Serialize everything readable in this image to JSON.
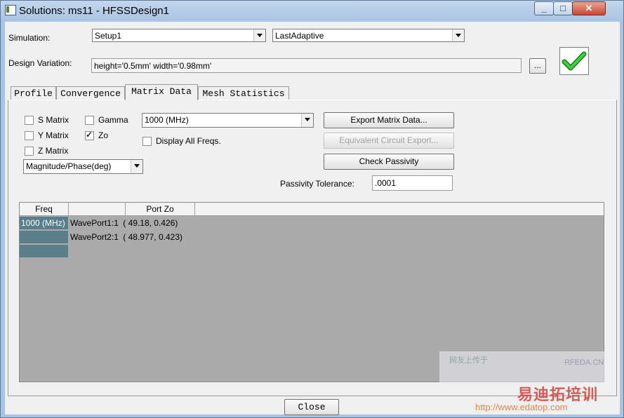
{
  "window": {
    "title": "Solutions: ms11 - HFSSDesign1"
  },
  "titlebar": {
    "minimize": "_",
    "maximize": "□",
    "close": "✕"
  },
  "simulation": {
    "label": "Simulation:",
    "setup": "Setup1",
    "solution": "LastAdaptive"
  },
  "design_variation": {
    "label": "Design Variation:",
    "value": "height='0.5mm' width='0.98mm'",
    "browse_button": "..."
  },
  "status_icon": "checkmark-icon",
  "tabs": [
    {
      "label": "Profile"
    },
    {
      "label": "Convergence"
    },
    {
      "label": "Matrix Data"
    },
    {
      "label": "Mesh Statistics"
    }
  ],
  "active_tab": "Matrix Data",
  "matrix_options": {
    "s_matrix": {
      "label": "S Matrix",
      "checked": false
    },
    "y_matrix": {
      "label": "Y Matrix",
      "checked": false
    },
    "z_matrix": {
      "label": "Z Matrix",
      "checked": false
    },
    "gamma": {
      "label": "Gamma",
      "checked": false
    },
    "zo": {
      "label": "Zo",
      "checked": true
    },
    "display_all_freqs": {
      "label": "Display All Freqs.",
      "checked": false
    },
    "frequency": "1000 (MHz)",
    "format": "Magnitude/Phase(deg)",
    "checkmark": "✓"
  },
  "buttons": {
    "export_matrix": "Export Matrix Data...",
    "equiv_circuit": "Equivalent Circuit Export...",
    "check_passivity": "Check Passivity",
    "close": "Close"
  },
  "passivity": {
    "label": "Passivity Tolerance:",
    "value": ".0001"
  },
  "grid": {
    "headers": [
      "Freq",
      "",
      "Port Zo"
    ],
    "freq": "1000 (MHz)",
    "rows": [
      {
        "port": "WavePort1:1",
        "value": "( 49.18,    0.426)"
      },
      {
        "port": "WavePort2:1",
        "value": "( 48.977,    0.423)"
      }
    ]
  },
  "watermark": {
    "line1": "网友上传于",
    "brand": "RFEDA.CN",
    "cn_text": "易迪拓培训",
    "url": "http://www.edatop.com"
  }
}
